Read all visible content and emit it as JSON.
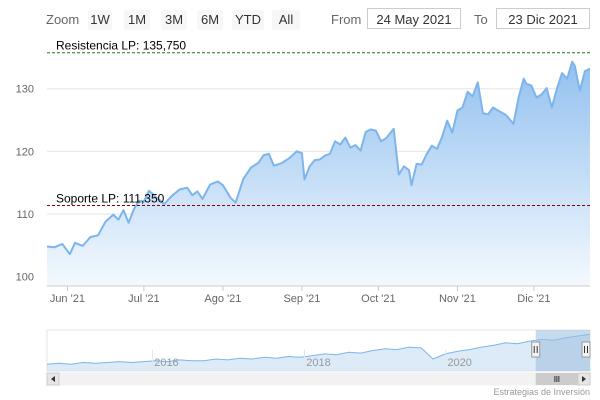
{
  "toolbar": {
    "zoom_label": "Zoom",
    "zoom_buttons": [
      "1W",
      "1M",
      "3M",
      "6M",
      "YTD",
      "All"
    ],
    "from_label": "From",
    "from_value": "24 May 2021",
    "to_label": "To",
    "to_value": "23 Dic 2021"
  },
  "credits": "Estrategias de Inversión",
  "colors": {
    "series_line": "#7cb5ec",
    "area_top": "#93c1ef",
    "area_bottom": "#f4f9fe",
    "resistance_line": "#1a7a1a",
    "support_line": "#8b0000",
    "navigator_fill": "#c7dcf2",
    "navigator_mask": "#9bbde0"
  },
  "chart_data": {
    "type": "area",
    "y_ticks": [
      100,
      110,
      120,
      130
    ],
    "ylim": [
      98.5,
      136.5
    ],
    "x_ticks": [
      {
        "label": "Jun '21",
        "date": "2021-06-01"
      },
      {
        "label": "Jul '21",
        "date": "2021-07-01"
      },
      {
        "label": "Ago '21",
        "date": "2021-08-01"
      },
      {
        "label": "Sep '21",
        "date": "2021-09-01"
      },
      {
        "label": "Oct '21",
        "date": "2021-10-01"
      },
      {
        "label": "Nov '21",
        "date": "2021-11-01"
      },
      {
        "label": "Dic '21",
        "date": "2021-12-01"
      }
    ],
    "xlim": [
      "2021-05-24",
      "2021-12-23"
    ],
    "plot_lines": [
      {
        "label": "Resistencia LP: 135,750",
        "value": 135.75,
        "style": "dashed",
        "color": "#1a7a1a"
      },
      {
        "label": "Soporte LP: 111,350",
        "value": 111.35,
        "style": "dashed",
        "color": "#8b0000"
      }
    ],
    "series": [
      {
        "points": [
          [
            "2021-05-24",
            104.8
          ],
          [
            "2021-05-27",
            104.7
          ],
          [
            "2021-05-30",
            105.2
          ],
          [
            "2021-06-02",
            103.6
          ],
          [
            "2021-06-04",
            105.4
          ],
          [
            "2021-06-07",
            104.9
          ],
          [
            "2021-06-10",
            106.3
          ],
          [
            "2021-06-13",
            106.6
          ],
          [
            "2021-06-16",
            108.8
          ],
          [
            "2021-06-19",
            109.9
          ],
          [
            "2021-06-21",
            109.1
          ],
          [
            "2021-06-23",
            110.6
          ],
          [
            "2021-06-25",
            108.6
          ],
          [
            "2021-06-27",
            110.7
          ],
          [
            "2021-06-29",
            112.1
          ],
          [
            "2021-07-01",
            112.0
          ],
          [
            "2021-07-03",
            113.7
          ],
          [
            "2021-07-06",
            112.6
          ],
          [
            "2021-07-09",
            111.6
          ],
          [
            "2021-07-12",
            112.9
          ],
          [
            "2021-07-15",
            113.9
          ],
          [
            "2021-07-18",
            114.2
          ],
          [
            "2021-07-20",
            113.0
          ],
          [
            "2021-07-22",
            113.6
          ],
          [
            "2021-07-24",
            112.4
          ],
          [
            "2021-07-27",
            114.7
          ],
          [
            "2021-07-30",
            115.2
          ],
          [
            "2021-08-01",
            114.6
          ],
          [
            "2021-08-04",
            112.6
          ],
          [
            "2021-08-06",
            111.8
          ],
          [
            "2021-08-09",
            115.6
          ],
          [
            "2021-08-12",
            117.4
          ],
          [
            "2021-08-15",
            118.2
          ],
          [
            "2021-08-17",
            119.4
          ],
          [
            "2021-08-19",
            119.6
          ],
          [
            "2021-08-21",
            117.7
          ],
          [
            "2021-08-24",
            118.1
          ],
          [
            "2021-08-27",
            118.9
          ],
          [
            "2021-08-30",
            120.0
          ],
          [
            "2021-09-01",
            119.7
          ],
          [
            "2021-09-02",
            115.5
          ],
          [
            "2021-09-04",
            117.6
          ],
          [
            "2021-09-06",
            118.6
          ],
          [
            "2021-09-08",
            118.7
          ],
          [
            "2021-09-10",
            119.3
          ],
          [
            "2021-09-12",
            119.6
          ],
          [
            "2021-09-14",
            121.6
          ],
          [
            "2021-09-16",
            121.1
          ],
          [
            "2021-09-18",
            122.2
          ],
          [
            "2021-09-20",
            120.6
          ],
          [
            "2021-09-22",
            121.0
          ],
          [
            "2021-09-24",
            120.1
          ],
          [
            "2021-09-26",
            123.1
          ],
          [
            "2021-09-28",
            123.5
          ],
          [
            "2021-09-30",
            123.3
          ],
          [
            "2021-10-02",
            121.6
          ],
          [
            "2021-10-04",
            122.1
          ],
          [
            "2021-10-07",
            123.6
          ],
          [
            "2021-10-09",
            116.3
          ],
          [
            "2021-10-11",
            117.6
          ],
          [
            "2021-10-13",
            117.0
          ],
          [
            "2021-10-14",
            114.6
          ],
          [
            "2021-10-16",
            118.0
          ],
          [
            "2021-10-18",
            117.9
          ],
          [
            "2021-10-20",
            119.6
          ],
          [
            "2021-10-22",
            120.9
          ],
          [
            "2021-10-24",
            120.4
          ],
          [
            "2021-10-26",
            122.3
          ],
          [
            "2021-10-28",
            124.9
          ],
          [
            "2021-10-30",
            123.0
          ],
          [
            "2021-11-01",
            126.5
          ],
          [
            "2021-11-03",
            127.0
          ],
          [
            "2021-11-05",
            129.5
          ],
          [
            "2021-11-07",
            128.8
          ],
          [
            "2021-11-09",
            131.0
          ],
          [
            "2021-11-11",
            126.1
          ],
          [
            "2021-11-13",
            125.9
          ],
          [
            "2021-11-15",
            127.0
          ],
          [
            "2021-11-17",
            126.5
          ],
          [
            "2021-11-20",
            125.8
          ],
          [
            "2021-11-23",
            124.4
          ],
          [
            "2021-11-25",
            128.6
          ],
          [
            "2021-11-27",
            131.6
          ],
          [
            "2021-11-28",
            130.8
          ],
          [
            "2021-11-30",
            130.5
          ],
          [
            "2021-12-02",
            128.6
          ],
          [
            "2021-12-04",
            129.1
          ],
          [
            "2021-12-06",
            130.1
          ],
          [
            "2021-12-08",
            127.0
          ],
          [
            "2021-12-10",
            130.0
          ],
          [
            "2021-12-12",
            132.5
          ],
          [
            "2021-12-14",
            131.6
          ],
          [
            "2021-12-16",
            134.3
          ],
          [
            "2021-12-17",
            133.7
          ],
          [
            "2021-12-19",
            129.7
          ],
          [
            "2021-12-21",
            132.8
          ],
          [
            "2021-12-23",
            133.2
          ]
        ]
      }
    ]
  },
  "navigator": {
    "x_labels": [
      "2016",
      "2018",
      "2020"
    ],
    "series": [
      100,
      101,
      100,
      102,
      101,
      102,
      103,
      102,
      103,
      104,
      103,
      105,
      104,
      104,
      106,
      105,
      107,
      106,
      108,
      107,
      109,
      108,
      110,
      112,
      111,
      114,
      113,
      116,
      118,
      117,
      120,
      119,
      106,
      112,
      115,
      117,
      120,
      122,
      125,
      124,
      127,
      129,
      128,
      131,
      133,
      135
    ],
    "selected_from_fraction": 0.9
  }
}
